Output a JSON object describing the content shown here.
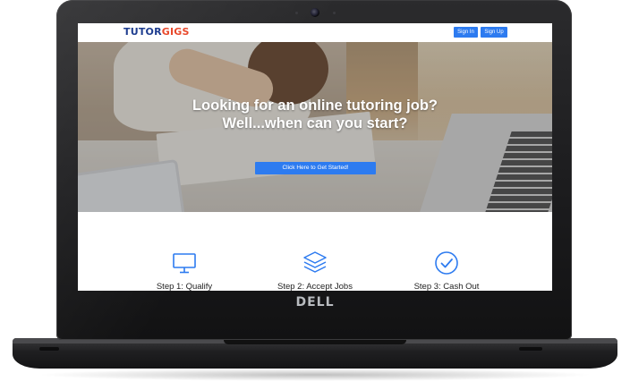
{
  "device": {
    "brand": "DELL"
  },
  "site": {
    "logo": {
      "part1": "TUTOR",
      "part2": "GIGS"
    },
    "nav": {
      "sign_in": "Sign In",
      "sign_up": "Sign Up"
    },
    "hero": {
      "headline_line1": "Looking for an online tutoring job?",
      "headline_line2": "Well...when can you start?",
      "cta": "Click Here to Get Started!"
    },
    "steps": [
      {
        "label": "Step 1: Qualify",
        "icon": "monitor-icon"
      },
      {
        "label": "Step 2: Accept Jobs",
        "icon": "layers-icon"
      },
      {
        "label": "Step 3: Cash Out",
        "icon": "check-circle-icon"
      }
    ]
  },
  "colors": {
    "accent": "#2d7bf0",
    "logo_primary": "#1e3d8f",
    "logo_secondary": "#e8492c"
  }
}
